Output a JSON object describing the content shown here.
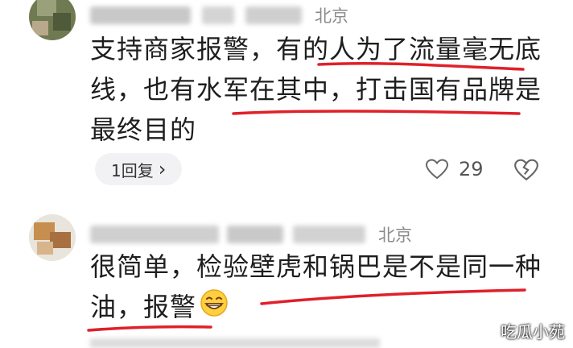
{
  "comments": [
    {
      "location": "北京",
      "lines": [
        "支持商家报警，有的人为了流量毫无底",
        "线，也有水军在其中，打击国有品牌是",
        "最终目的"
      ],
      "reply_label": "1回复",
      "reply_chevron": "›",
      "likes": "29",
      "icons": [
        "heart-outline-icon",
        "broken-heart-icon"
      ]
    },
    {
      "location": "北京",
      "lines": [
        "很简单，检验壁虎和锅巴是不是同一种",
        "油，报警"
      ],
      "emoji": "grinning-face-emoji"
    }
  ],
  "watermark": "吃瓜小苑",
  "colors": {
    "underline": "#e0202a",
    "reply_bg": "#f2f2f4",
    "meta_text": "#8a8a8a"
  }
}
